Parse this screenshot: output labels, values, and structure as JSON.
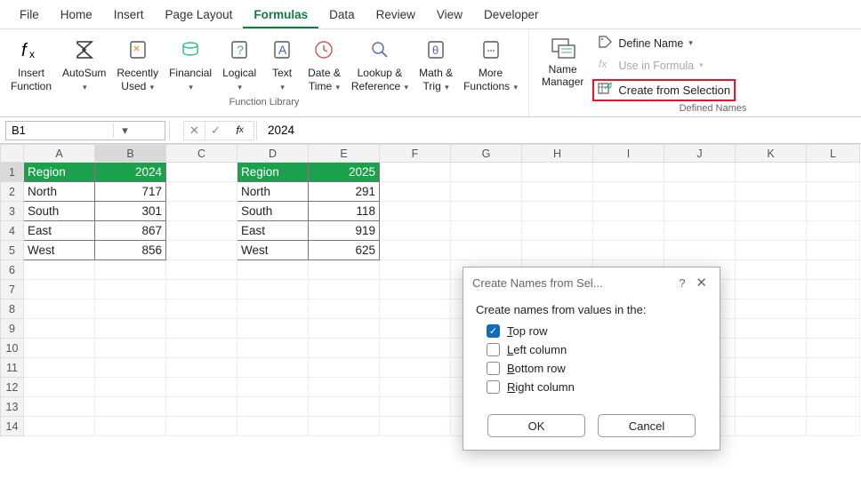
{
  "tabs": [
    "File",
    "Home",
    "Insert",
    "Page Layout",
    "Formulas",
    "Data",
    "Review",
    "View",
    "Developer"
  ],
  "active_tab": "Formulas",
  "ribbon": {
    "insert_function": "Insert\nFunction",
    "autosum": "AutoSum",
    "recently_used": "Recently\nUsed",
    "financial": "Financial",
    "logical": "Logical",
    "text": "Text",
    "date_time": "Date &\nTime",
    "lookup_ref": "Lookup &\nReference",
    "math_trig": "Math &\nTrig",
    "more_functions": "More\nFunctions",
    "group1_label": "Function Library",
    "name_manager": "Name\nManager",
    "define_name": "Define Name",
    "use_in_formula": "Use in Formula",
    "create_from_selection": "Create from Selection",
    "group2_label": "Defined Names"
  },
  "namebox_value": "B1",
  "formula_value": "2024",
  "columns": [
    "A",
    "B",
    "C",
    "D",
    "E",
    "F",
    "G",
    "H",
    "I",
    "J",
    "K",
    "L"
  ],
  "selected_col": "B",
  "selected_row": 1,
  "row_count": 14,
  "table1": {
    "headers": [
      "Region",
      "2024"
    ],
    "rows": [
      [
        "North",
        "717"
      ],
      [
        "South",
        "301"
      ],
      [
        "East",
        "867"
      ],
      [
        "West",
        "856"
      ]
    ]
  },
  "table2": {
    "headers": [
      "Region",
      "2025"
    ],
    "rows": [
      [
        "North",
        "291"
      ],
      [
        "South",
        "118"
      ],
      [
        "East",
        "919"
      ],
      [
        "West",
        "625"
      ]
    ]
  },
  "dialog": {
    "title": "Create Names from Sel...",
    "prompt": "Create names from values in the:",
    "options": {
      "top_row": {
        "label": "Top row",
        "checked": true
      },
      "left_column": {
        "label": "Left column",
        "checked": false
      },
      "bottom_row": {
        "label": "Bottom row",
        "checked": false
      },
      "right_column": {
        "label": "Right column",
        "checked": false
      }
    },
    "ok": "OK",
    "cancel": "Cancel"
  }
}
